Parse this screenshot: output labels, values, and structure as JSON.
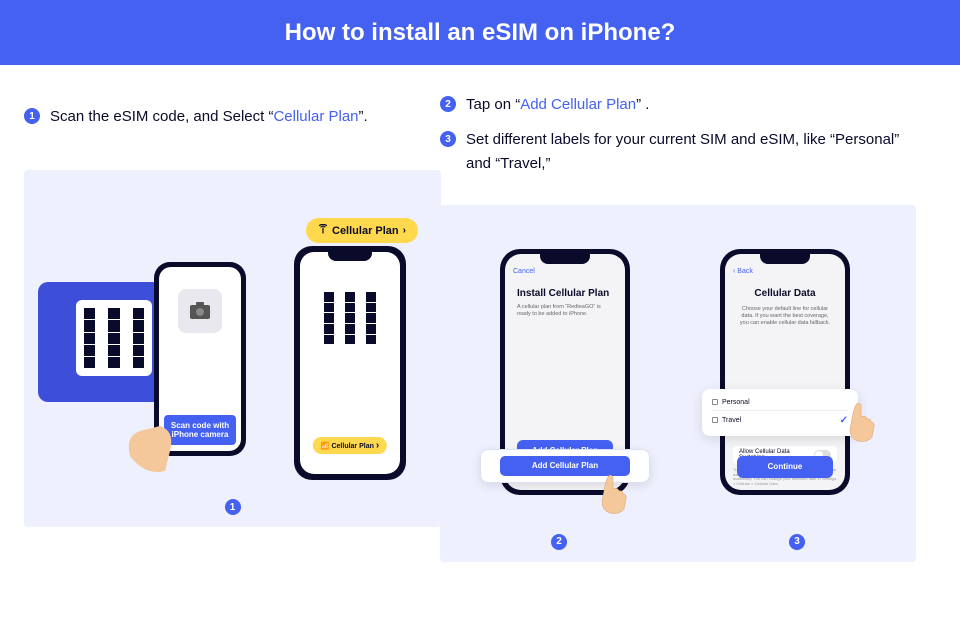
{
  "header": {
    "title": "How to install an eSIM on iPhone?"
  },
  "steps": {
    "s1": {
      "num": "1",
      "pre": "Scan the eSIM code, and Select “",
      "hl": "Cellular Plan",
      "post": "”."
    },
    "s2": {
      "num": "2",
      "pre": "Tap on “",
      "hl": "Add Cellular Plan",
      "post": "” ."
    },
    "s3": {
      "num": "3",
      "text": "Set different labels for your current SIM and eSIM, like “Personal” and “Travel,”"
    }
  },
  "panel1": {
    "scan_label": "Scan code with iPhone camera",
    "chip_top": "Cellular Plan",
    "chip_small": "Cellular Plan",
    "caption": "1"
  },
  "panel2": {
    "phone2": {
      "cancel": "Cancel",
      "title": "Install Cellular Plan",
      "sub": "A cellular plan from “RedteaGO” is ready to be added to iPhone.",
      "btn": "Add Cellular Plan"
    },
    "float_btn": "Add Cellular Plan",
    "phone3": {
      "back": "‹ Back",
      "title": "Cellular Data",
      "sub": "Choose your default line for cellular data. If you want the best coverage, you can enable cellular data fallback.",
      "row1": "Personal",
      "row2": "Travel",
      "switch": "Allow Cellular Data Switching",
      "fine": "Turning this feature on will allow your phone to use cellular data from both lines depending on coverage and availability. You can change your selection later in Settings > Cellular > Cellular Data.",
      "btn": "Continue"
    },
    "caption2": "2",
    "caption3": "3"
  }
}
